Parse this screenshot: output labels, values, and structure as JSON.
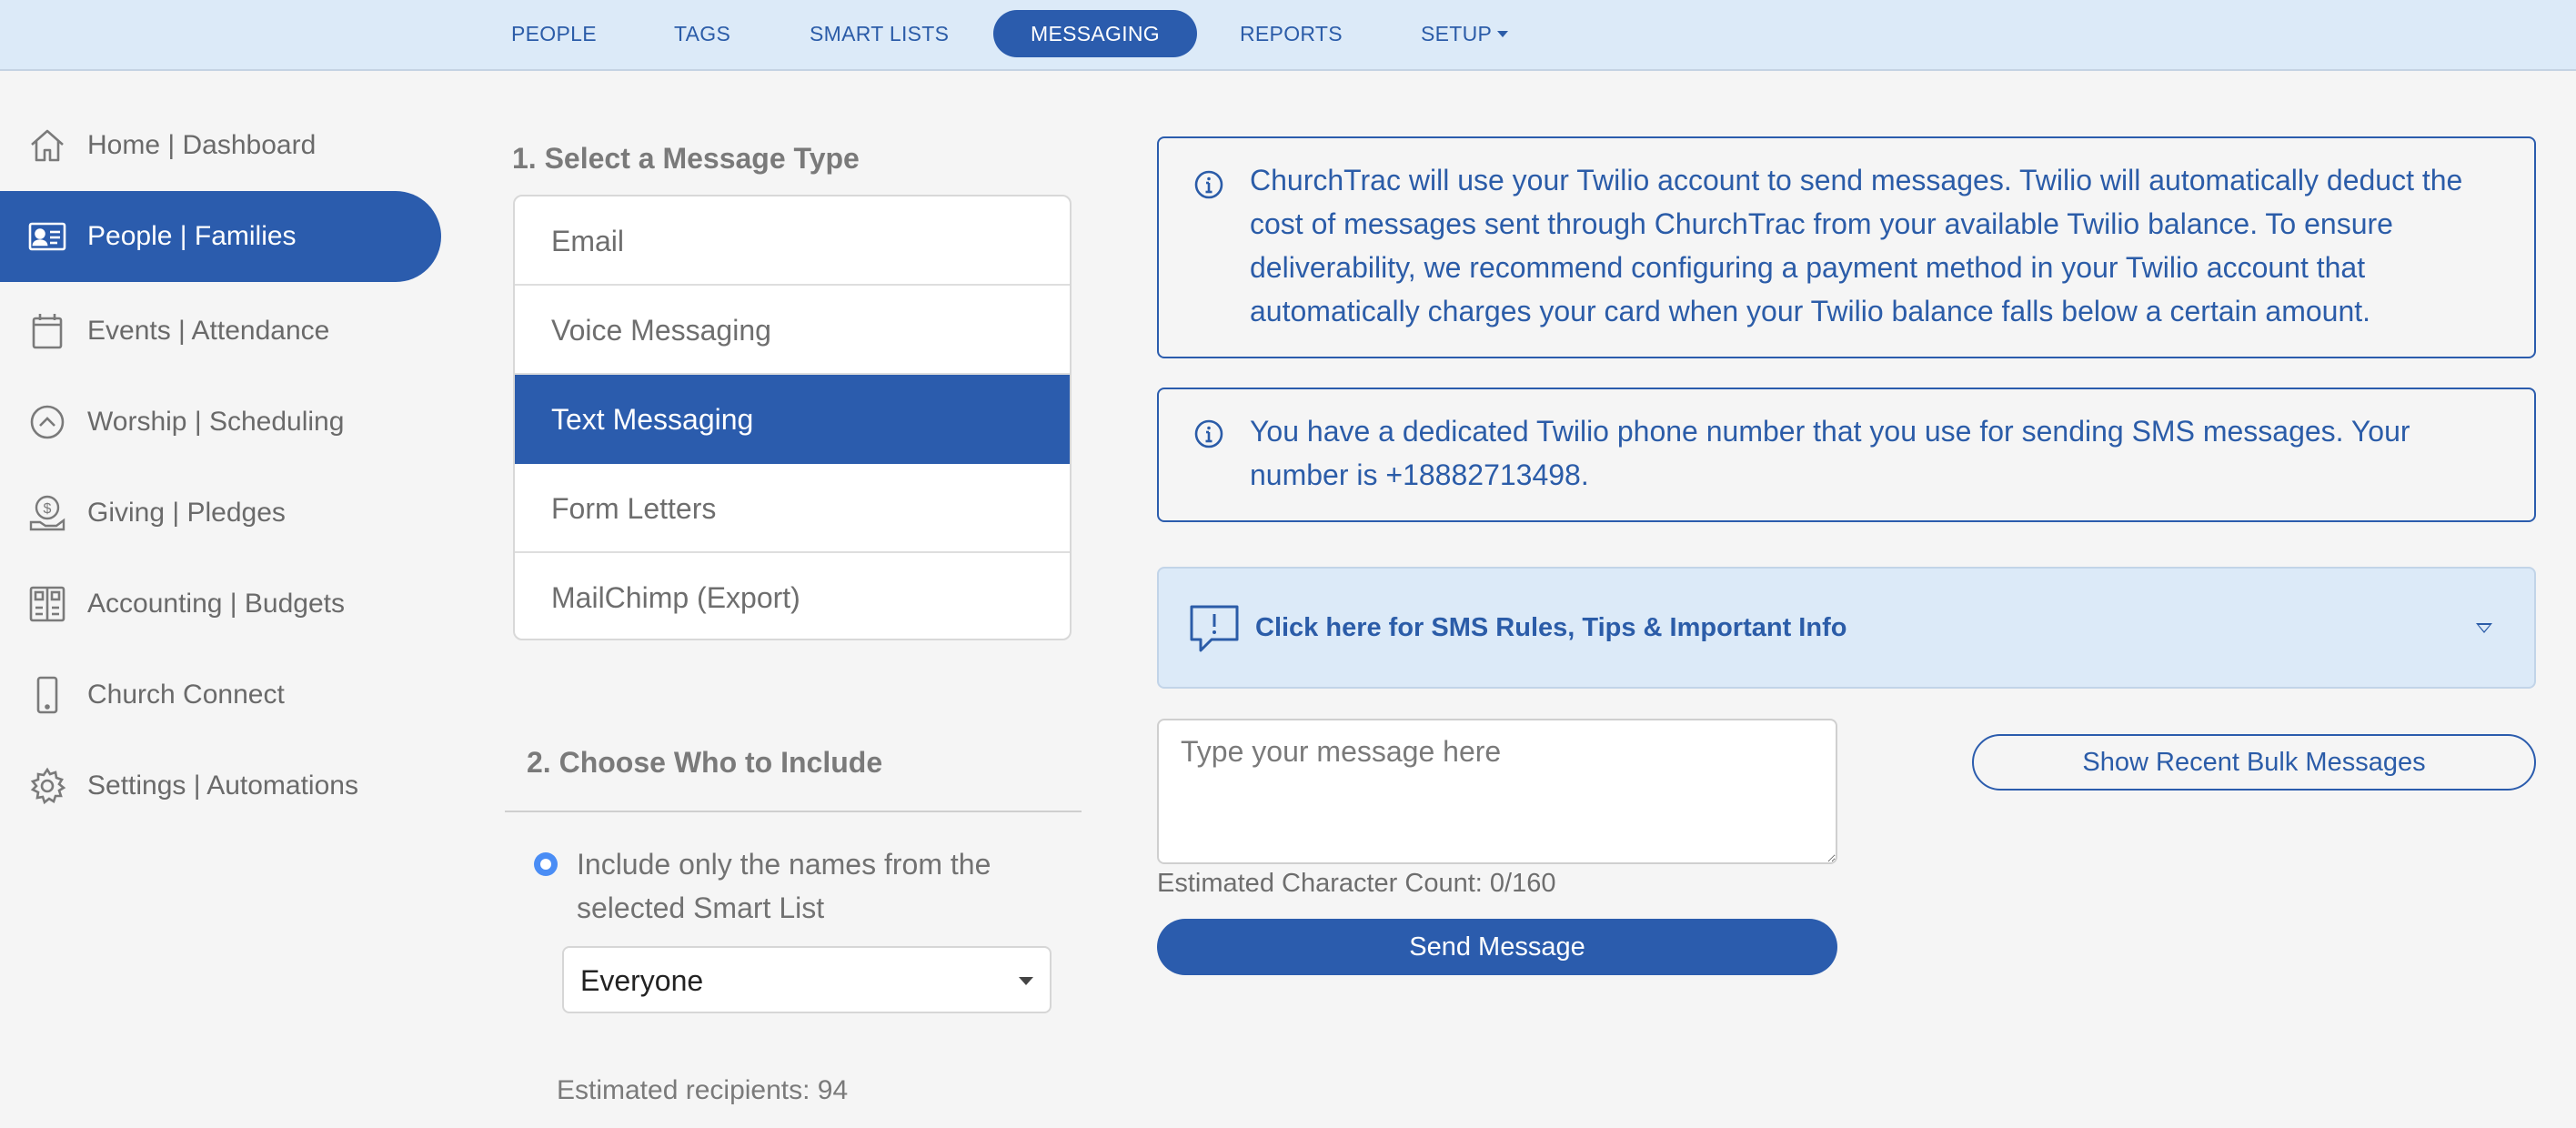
{
  "nav": {
    "tabs": [
      {
        "label": "PEOPLE"
      },
      {
        "label": "TAGS"
      },
      {
        "label": "SMART LISTS"
      },
      {
        "label": "MESSAGING",
        "active": true
      },
      {
        "label": "REPORTS"
      },
      {
        "label": "SETUP"
      }
    ]
  },
  "sidebar": {
    "items": [
      {
        "label": "Home | Dashboard",
        "icon": "home-icon"
      },
      {
        "label": "People | Families",
        "icon": "id-card-icon",
        "active": true
      },
      {
        "label": "Events | Attendance",
        "icon": "calendar-icon"
      },
      {
        "label": "Worship | Scheduling",
        "icon": "chevron-up-circle-icon"
      },
      {
        "label": "Giving | Pledges",
        "icon": "dollar-hand-icon"
      },
      {
        "label": "Accounting | Budgets",
        "icon": "ledger-icon"
      },
      {
        "label": "Church Connect",
        "icon": "mobile-phone-icon"
      },
      {
        "label": "Settings | Automations",
        "icon": "gear-icon"
      }
    ]
  },
  "step1": {
    "title": "1. Select a Message Type",
    "types": [
      {
        "label": "Email"
      },
      {
        "label": "Voice Messaging"
      },
      {
        "label": "Text Messaging",
        "active": true
      },
      {
        "label": "Form Letters"
      },
      {
        "label": "MailChimp (Export)"
      }
    ]
  },
  "step2": {
    "title": "2. Choose Who to Include",
    "radio_label": "Include only the names from the selected Smart List",
    "smart_list_selected": "Everyone",
    "recipients": "Estimated recipients: 94"
  },
  "info": {
    "twilio_notice": "ChurchTrac will use your Twilio account to send messages. Twilio will automatically deduct the cost of messages sent through ChurchTrac from your available Twilio balance. To ensure deliverability, we recommend configuring a payment method in your Twilio account that automatically charges your card when your Twilio balance falls below a certain amount.",
    "phone_notice": "You have a dedicated Twilio phone number that you use for sending SMS messages. Your number is +18882713498.",
    "sms_rules": "Click here for SMS Rules, Tips & Important Info"
  },
  "compose": {
    "placeholder": "Type your message here",
    "char_count": "Estimated Character Count: 0/160",
    "send_label": "Send Message",
    "recent_label": "Show Recent Bulk Messages"
  },
  "colors": {
    "accent": "#2b5cad",
    "nav_bg": "#dceaf8",
    "page_bg": "#f5f5f5"
  }
}
